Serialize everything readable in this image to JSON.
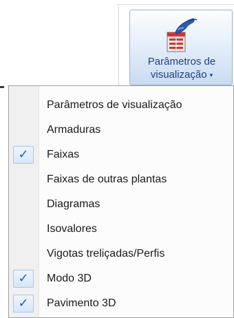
{
  "ribbon": {
    "button_label_line1": "Parâmetros de",
    "button_label_line2": "visualização",
    "button_icon": "display-parameters-icon",
    "dropdown_indicator": "▾"
  },
  "menu": {
    "check_glyph": "✓",
    "items": [
      {
        "label": "Parâmetros de visualização",
        "checked": false
      },
      {
        "label": "Armaduras",
        "checked": false
      },
      {
        "label": "Faixas",
        "checked": true
      },
      {
        "label": "Faixas de outras plantas",
        "checked": false
      },
      {
        "label": "Diagramas",
        "checked": false
      },
      {
        "label": "Isovalores",
        "checked": false
      },
      {
        "label": "Vigotas treliçadas/Perfis",
        "checked": false
      },
      {
        "label": "Modo 3D",
        "checked": true
      },
      {
        "label": "Pavimento 3D",
        "checked": true
      }
    ]
  },
  "colors": {
    "ribbon_text": "#1f3f87",
    "check_color": "#1e5fb3",
    "check_background": "#d7e7fa"
  }
}
